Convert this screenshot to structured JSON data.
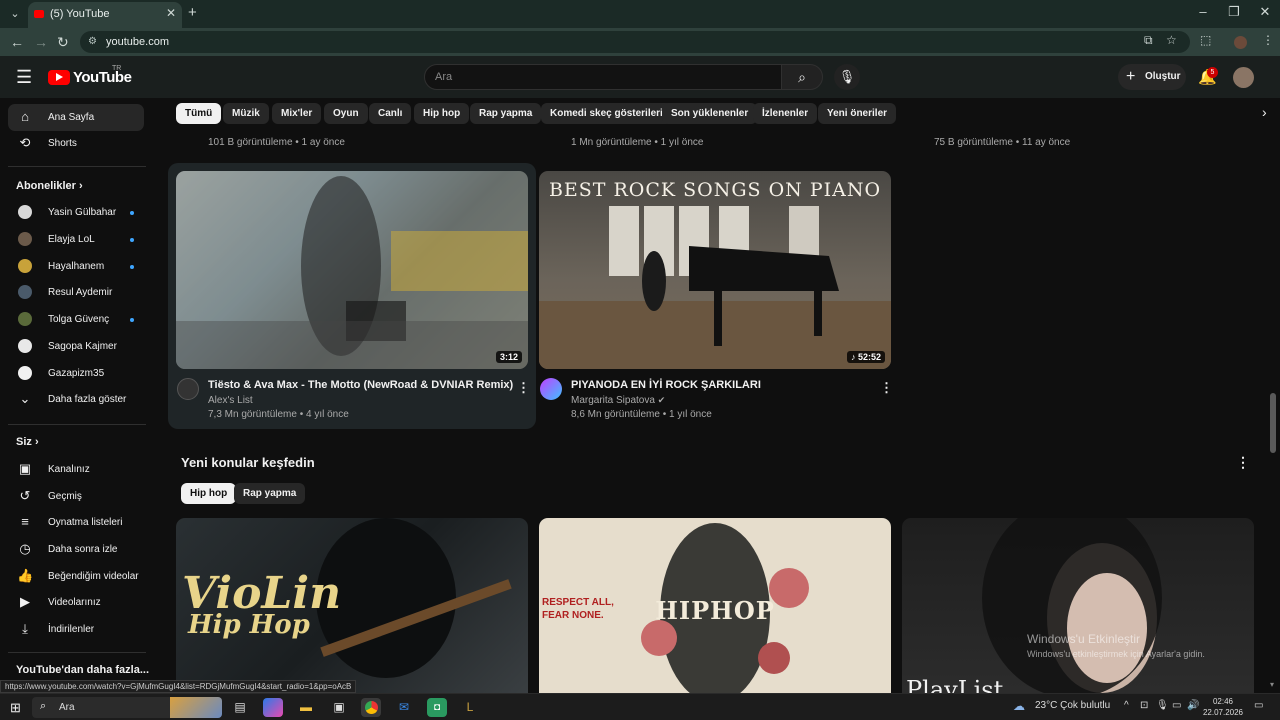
{
  "browser": {
    "tab_title": "(5) YouTube",
    "url": "youtube.com"
  },
  "header": {
    "logo_text": "YouTube",
    "logo_country": "TR",
    "search_placeholder": "Ara",
    "create_label": "Oluştur",
    "notification_count": "5"
  },
  "sidebar": {
    "main": [
      {
        "label": "Ana Sayfa",
        "icon": "home-icon"
      },
      {
        "label": "Shorts",
        "icon": "shorts-icon"
      }
    ],
    "subscriptions_title": "Abonelikler",
    "subscriptions": [
      {
        "label": "Yasin Gülbahar",
        "color": "#d8d8d8"
      },
      {
        "label": "Elayja LoL",
        "color": "#6b5a4a"
      },
      {
        "label": "Hayalhanem",
        "color": "#c8a23a"
      },
      {
        "label": "Resul Aydemir",
        "color": "#4a5a6a"
      },
      {
        "label": "Tolga Güvenç",
        "color": "#5a6a3a"
      },
      {
        "label": "Sagopa Kajmer",
        "color": "#e8e8e8"
      },
      {
        "label": "Gazapizm35",
        "color": "#f1f1f1"
      }
    ],
    "show_more": "Daha fazla göster",
    "you_title": "Siz",
    "you_items": [
      {
        "label": "Kanalınız",
        "icon": "channel-icon"
      },
      {
        "label": "Geçmiş",
        "icon": "history-icon"
      },
      {
        "label": "Oynatma listeleri",
        "icon": "playlist-icon"
      },
      {
        "label": "Daha sonra izle",
        "icon": "clock-icon"
      },
      {
        "label": "Beğendiğim videolar",
        "icon": "thumbs-up-icon"
      },
      {
        "label": "Videolarınız",
        "icon": "video-icon"
      },
      {
        "label": "İndirilenler",
        "icon": "download-icon"
      }
    ],
    "more_from_youtube": "YouTube'dan daha fazla..."
  },
  "chips": [
    "Tümü",
    "Müzik",
    "Mix'ler",
    "Oyun",
    "Canlı",
    "Hip hop",
    "Rap yapma",
    "Komedi skeç gösterileri",
    "Son yüklenenler",
    "İzlenenler",
    "Yeni öneriler"
  ],
  "prev_row_meta": [
    "101 B görüntüleme • 1 ay önce",
    "1 Mn görüntüleme • 1 yıl önce",
    "75 B görüntüleme • 11 ay önce"
  ],
  "videos": [
    {
      "title": "Tiësto & Ava Max - The Motto (NewRoad & DVNIAR Remix)",
      "channel": "Alex's List",
      "meta": "7,3 Mn görüntüleme • 4 yıl önce",
      "duration": "3:12"
    },
    {
      "title": "PIYANODA EN İYİ ROCK ŞARKILARI",
      "channel": "Margarita Sipatova",
      "meta": "8,6 Mn görüntüleme • 1 yıl önce",
      "duration": "52:52",
      "thumb_text": "BEST ROCK SONGS ON PIANO"
    }
  ],
  "explore": {
    "title": "Yeni konular keşfedin",
    "chips": [
      "Hip hop",
      "Rap yapma"
    ],
    "thumb_texts": [
      "VioLin",
      "Hip Hop",
      "RESPECT ALL,",
      "FEAR NONE.",
      "HIPHOP",
      "PlayList"
    ]
  },
  "status_url": "https://www.youtube.com/watch?v=GjMufmGugI4&list=RDGjMufmGugI4&start_radio=1&pp=oAcB",
  "watermark": {
    "line1": "Windows'u Etkinleştir",
    "line2": "Windows'u etkinleştirmek için Ayarlar'a gidin."
  },
  "taskbar": {
    "search_text": "Ara",
    "weather": "23°C  Çok bulutlu",
    "time": "02:46",
    "date": "22.07.2026"
  }
}
